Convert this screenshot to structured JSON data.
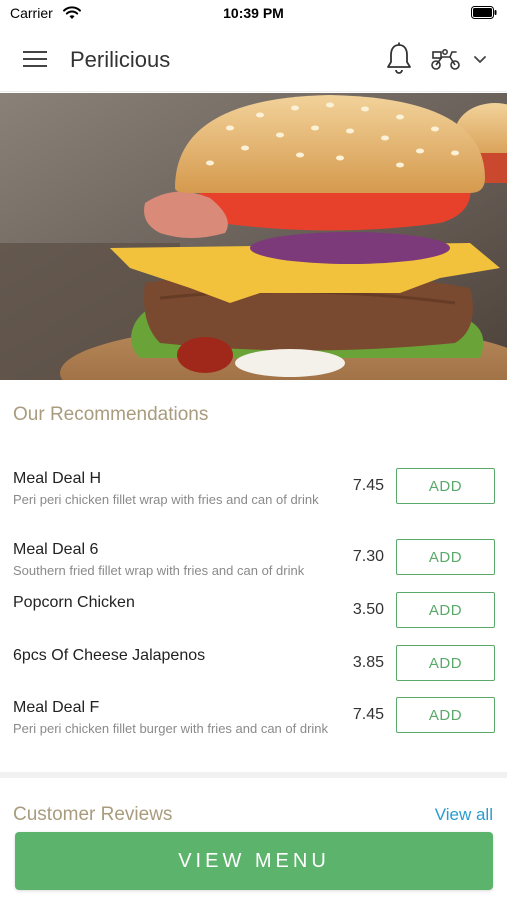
{
  "status_bar": {
    "carrier": "Carrier",
    "time": "10:39 PM",
    "icons": [
      "wifi-icon",
      "battery-icon"
    ]
  },
  "nav": {
    "title": "Perilicious",
    "icons": [
      "menu-icon",
      "bell-icon",
      "delivery-scooter-icon",
      "chevron-down-icon"
    ]
  },
  "hero": {
    "image": "burger-photo"
  },
  "recommendations": {
    "title": "Our Recommendations",
    "add_label": "ADD",
    "items": [
      {
        "name": "Meal Deal H",
        "description": "Peri peri chicken fillet wrap with fries and can of drink",
        "price": "7.45"
      },
      {
        "name": "Meal Deal 6",
        "description": "Southern fried fillet wrap with fries and can of drink",
        "price": "7.30"
      },
      {
        "name": "Popcorn Chicken",
        "description": "",
        "price": "3.50"
      },
      {
        "name": "6pcs Of Cheese Jalapenos",
        "description": "",
        "price": "3.85"
      },
      {
        "name": "Meal Deal F",
        "description": "Peri peri chicken fillet burger with fries and can of drink",
        "price": "7.45"
      }
    ]
  },
  "reviews": {
    "title": "Customer Reviews",
    "view_all": "View all"
  },
  "footer": {
    "view_menu": "VIEW MENU"
  },
  "colors": {
    "accent_green": "#5cb36b",
    "section_title": "#a99b7e",
    "link_blue": "#2a9ccf"
  }
}
